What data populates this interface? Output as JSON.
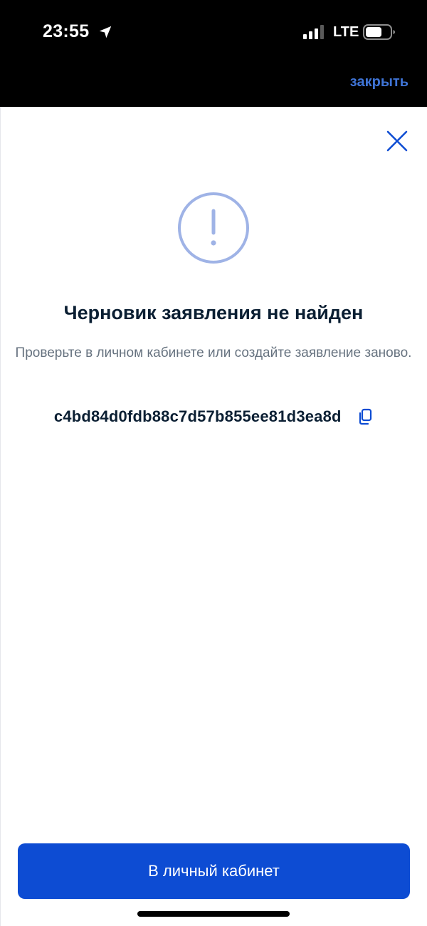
{
  "status_bar": {
    "time": "23:55",
    "network": "LTE",
    "icons": [
      "location-arrow-icon",
      "signal-icon",
      "battery-icon"
    ]
  },
  "top_bar": {
    "close_link": "закрыть"
  },
  "dialog": {
    "icon": "warning-circle-icon",
    "title": "Черновик заявления не найден",
    "subtitle": "Проверьте в личном кабинете или создайте заявление заново.",
    "draft_id": "c4bd84d0fdb88c7d57b855ee81d3ea8d",
    "primary_button": "В личный кабинет"
  },
  "colors": {
    "accent": "#0d4cd3",
    "icon_light": "#9fb3e6",
    "title_text": "#0b1f33",
    "muted_text": "#66727f",
    "link": "#3f74d6"
  }
}
